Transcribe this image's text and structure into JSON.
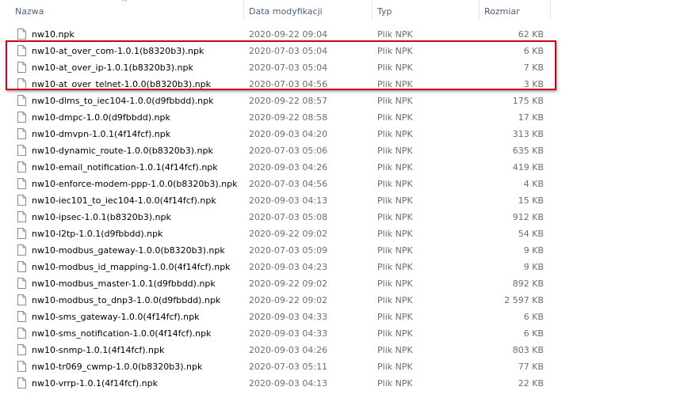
{
  "columns": {
    "name": "Nazwa",
    "date": "Data modyfikacji",
    "type": "Typ",
    "size": "Rozmiar"
  },
  "sort_indicator": "^",
  "files": [
    {
      "name": "nw10.npk",
      "date": "2020-09-22 09:04",
      "type": "Plik NPK",
      "size": "62 KB"
    },
    {
      "name": "nw10-at_over_com-1.0.1(b8320b3).npk",
      "date": "2020-07-03 05:04",
      "type": "Plik NPK",
      "size": "6 KB"
    },
    {
      "name": "nw10-at_over_ip-1.0.1(b8320b3).npk",
      "date": "2020-07-03 05:04",
      "type": "Plik NPK",
      "size": "7 KB"
    },
    {
      "name": "nw10-at_over_telnet-1.0.0(b8320b3).npk",
      "date": "2020-07-03 04:56",
      "type": "Plik NPK",
      "size": "3 KB"
    },
    {
      "name": "nw10-dlms_to_iec104-1.0.0(d9fbbdd).npk",
      "date": "2020-09-22 08:57",
      "type": "Plik NPK",
      "size": "175 KB"
    },
    {
      "name": "nw10-dmpc-1.0.0(d9fbbdd).npk",
      "date": "2020-09-22 08:58",
      "type": "Plik NPK",
      "size": "17 KB"
    },
    {
      "name": "nw10-dmvpn-1.0.1(4f14fcf).npk",
      "date": "2020-09-03 04:20",
      "type": "Plik NPK",
      "size": "313 KB"
    },
    {
      "name": "nw10-dynamic_route-1.0.0(b8320b3).npk",
      "date": "2020-07-03 05:06",
      "type": "Plik NPK",
      "size": "635 KB"
    },
    {
      "name": "nw10-email_notification-1.0.1(4f14fcf).npk",
      "date": "2020-09-03 04:26",
      "type": "Plik NPK",
      "size": "419 KB"
    },
    {
      "name": "nw10-enforce-modem-ppp-1.0.0(b8320b3).npk",
      "date": "2020-07-03 04:56",
      "type": "Plik NPK",
      "size": "4 KB"
    },
    {
      "name": "nw10-iec101_to_iec104-1.0.0(4f14fcf).npk",
      "date": "2020-09-03 04:13",
      "type": "Plik NPK",
      "size": "15 KB"
    },
    {
      "name": "nw10-ipsec-1.0.1(b8320b3).npk",
      "date": "2020-07-03 05:08",
      "type": "Plik NPK",
      "size": "912 KB"
    },
    {
      "name": "nw10-l2tp-1.0.1(d9fbbdd).npk",
      "date": "2020-09-22 09:02",
      "type": "Plik NPK",
      "size": "54 KB"
    },
    {
      "name": "nw10-modbus_gateway-1.0.0(b8320b3).npk",
      "date": "2020-07-03 05:09",
      "type": "Plik NPK",
      "size": "9 KB"
    },
    {
      "name": "nw10-modbus_id_mapping-1.0.0(4f14fcf).npk",
      "date": "2020-09-03 04:23",
      "type": "Plik NPK",
      "size": "9 KB"
    },
    {
      "name": "nw10-modbus_master-1.0.1(d9fbbdd).npk",
      "date": "2020-09-22 09:02",
      "type": "Plik NPK",
      "size": "892 KB"
    },
    {
      "name": "nw10-modbus_to_dnp3-1.0.0(d9fbbdd).npk",
      "date": "2020-09-22 09:02",
      "type": "Plik NPK",
      "size": "2 597 KB"
    },
    {
      "name": "nw10-sms_gateway-1.0.0(4f14fcf).npk",
      "date": "2020-09-03 04:33",
      "type": "Plik NPK",
      "size": "6 KB"
    },
    {
      "name": "nw10-sms_notification-1.0.0(4f14fcf).npk",
      "date": "2020-09-03 04:33",
      "type": "Plik NPK",
      "size": "6 KB"
    },
    {
      "name": "nw10-snmp-1.0.1(4f14fcf).npk",
      "date": "2020-09-03 04:26",
      "type": "Plik NPK",
      "size": "803 KB"
    },
    {
      "name": "nw10-tr069_cwmp-1.0.0(b8320b3).npk",
      "date": "2020-07-03 05:11",
      "type": "Plik NPK",
      "size": "77 KB"
    },
    {
      "name": "nw10-vrrp-1.0.1(4f14fcf).npk",
      "date": "2020-09-03 04:13",
      "type": "Plik NPK",
      "size": "22 KB"
    }
  ],
  "highlight_color": "#d0021b",
  "file_icon": "document-icon"
}
